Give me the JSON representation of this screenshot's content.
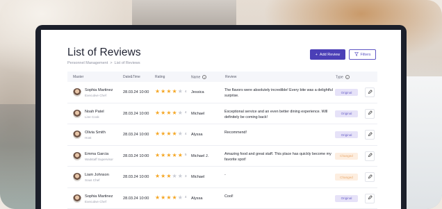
{
  "page": {
    "title": "List of Reviews",
    "breadcrumb": [
      "Personnel Management",
      ">",
      "List of Reviews"
    ]
  },
  "toolbar": {
    "add_label": "Add Review",
    "add_icon": "plus-icon",
    "filters_label": "Filters",
    "filters_icon": "funnel-icon"
  },
  "table": {
    "headers": {
      "master": "Master",
      "datetime": "Date&Time",
      "rating": "Rating",
      "name": "Name",
      "review": "Review",
      "type": "Type"
    },
    "rows": [
      {
        "master": "Sophia Martinez",
        "role": "Executive Chef",
        "datetime": "28.03.24 10:00",
        "rating": 4,
        "rating_label": "4",
        "name": "Jessica",
        "review": "The flavors were absolutely incredible! Every bite was a delightful surprise.",
        "type": "Original"
      },
      {
        "master": "Noah Patel",
        "role": "Line Cook",
        "datetime": "28.03.24 10:00",
        "rating": 4,
        "rating_label": "4",
        "name": "Michael",
        "review": "Exceptional service and an even better dining experience. Will definitely be coming back!",
        "type": "Original"
      },
      {
        "master": "Olivia Smith",
        "role": "Host",
        "datetime": "28.03.24 10:00",
        "rating": 4,
        "rating_label": "4",
        "name": "Alyssa",
        "review": "Recommend!",
        "type": "Original"
      },
      {
        "master": "Emma Garcia",
        "role": "Waitstaff Supervisor",
        "datetime": "28.03.24 10:00",
        "rating": 5,
        "rating_label": "5",
        "name": "Michael J.",
        "review": "Amazing food and great staff. This place has quickly become my favorite spot!",
        "type": "Changed"
      },
      {
        "master": "Liam Johnson",
        "role": "Sous Chef",
        "datetime": "28.03.24 10:00",
        "rating": 3,
        "rating_label": "3",
        "name": "Michael",
        "review": "-",
        "type": "Changed"
      },
      {
        "master": "Sophia Martinez",
        "role": "Executive Chef",
        "datetime": "28.03.24 10:00",
        "rating": 4,
        "rating_label": "4",
        "name": "Alyssa",
        "review": "Cool!",
        "type": "Original"
      }
    ]
  },
  "colors": {
    "accent": "#4b3fb7",
    "star": "#f5a623",
    "original_badge_bg": "#e6e2f8",
    "changed_badge_bg": "#fdeee0"
  }
}
